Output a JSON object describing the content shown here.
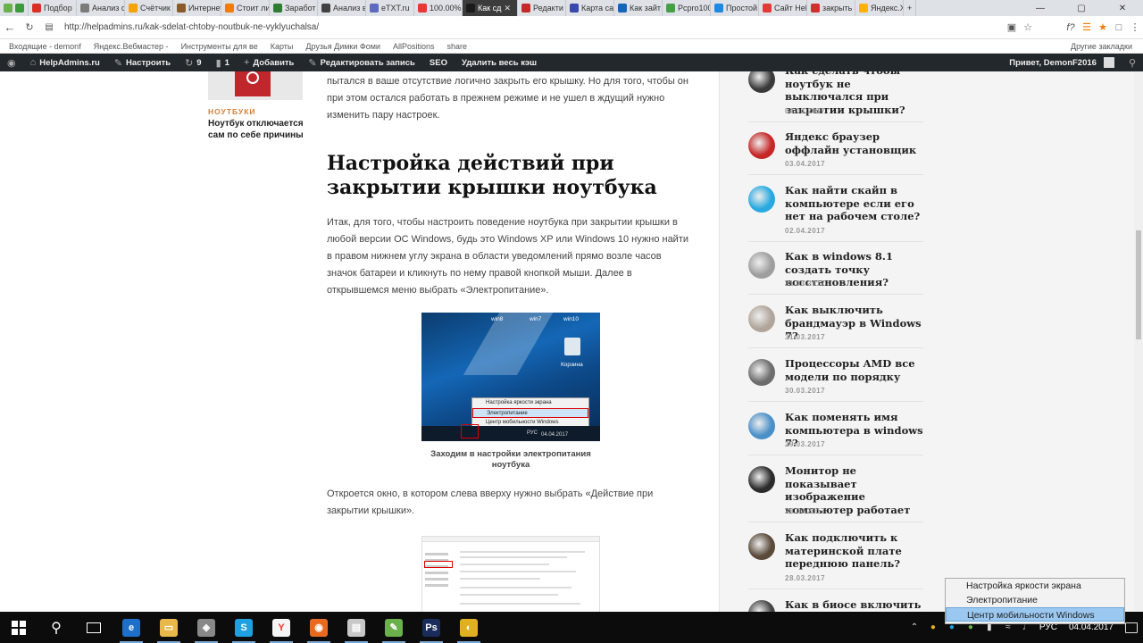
{
  "browser": {
    "tabs": [
      {
        "label": "Подбор",
        "color": "#d93025"
      },
      {
        "label": "Анализ с",
        "color": "#7b7b7b"
      },
      {
        "label": "Счётчик",
        "color": "#f4a300"
      },
      {
        "label": "Интернет",
        "color": "#8b5a2b"
      },
      {
        "label": "Стоит ли",
        "color": "#f57c00"
      },
      {
        "label": "Заработ",
        "color": "#2e7d32"
      },
      {
        "label": "Анализ в",
        "color": "#424242"
      },
      {
        "label": "eTXT.ru",
        "color": "#5c6bc0"
      },
      {
        "label": "100.00%",
        "color": "#e53935"
      },
      {
        "label": "Как сд",
        "color": "#1a1a1a",
        "active": true
      },
      {
        "label": "Редакти",
        "color": "#c62828"
      },
      {
        "label": "Карта са",
        "color": "#3949ab"
      },
      {
        "label": "Как зайт",
        "color": "#1565c0"
      },
      {
        "label": "Pcpro100",
        "color": "#43a047"
      },
      {
        "label": "Простой",
        "color": "#1e88e5"
      },
      {
        "label": "Сайт Hel",
        "color": "#e53935"
      },
      {
        "label": "закрыть",
        "color": "#d32f2f"
      },
      {
        "label": "Яндекс.Х",
        "color": "#ffb300"
      }
    ],
    "url": "http://helpadmins.ru/kak-sdelat-chtoby-noutbuk-ne-vyklyuchalsa/",
    "bookmarks": [
      "Входящие - demonf",
      "Яндекс.Вебмастер -",
      "Инструменты для ве",
      "Карты",
      "Друзья Димки Фоми",
      "AllPositions",
      "share"
    ],
    "other_bookmarks": "Другие закладки"
  },
  "wp_admin_bar": {
    "site": "HelpAdmins.ru",
    "customize": "Настроить",
    "updates_count": "9",
    "comments_count": "1",
    "add_new": "Добавить",
    "edit_post": "Редактировать запись",
    "seo": "SEO",
    "clear_cache": "Удалить весь кэш",
    "greeting": "Привет, DemonF2016"
  },
  "left_widget": {
    "category": "НОУТБУКИ",
    "caption": "Ноутбук отключается сам по себе причины"
  },
  "article": {
    "intro_paragraph": "пытался в ваше отсутствие логично закрыть его крышку. Но для того, чтобы он при этом остался работать в прежнем режиме и не ушел в ждущий нужно изменить пару настроек.",
    "heading": "Настройка действий при закрытии крышки ноутбука",
    "paragraph_2": "Итак, для того, чтобы настроить поведение ноутбука при закрытии крышки в любой версии ОС Windows, будь это Windows XP или Windows 10 нужно найти в правом нижнем углу экрана в области уведомлений прямо возле часов значок батареи и кликнуть по нему правой кнопкой мыши. Далее в открывшемся меню выбрать «Электропитание».",
    "image_1": {
      "labels": [
        "win8",
        "win7",
        "win10"
      ],
      "recycle_bin": "Корзина",
      "menu": [
        "Настройка яркости экрана",
        "Электропитание",
        "Центр мобильности Windows"
      ],
      "tray_lang": "РУС",
      "tray_date": "04.04.2017"
    },
    "caption_1": "Заходим в настройки электропитания ноутбука",
    "paragraph_3": "Откроется окно, в котором слева вверху нужно выбрать «Действие при закрытии крышки»."
  },
  "sidebar": {
    "items": [
      {
        "title": "Как сделать чтобы ноутбук не выключался при закрытии крышки?",
        "date": "04.04.2017",
        "thumb": "#3a3a3a"
      },
      {
        "title": "Яндекс браузер оффлайн установщик",
        "date": "03.04.2017",
        "thumb": "#c62828"
      },
      {
        "title": "Как найти скайп в компьютере если его нет на рабочем столе?",
        "date": "02.04.2017",
        "thumb": "#29a9e0"
      },
      {
        "title": "Как в windows 8.1 создать точку восстановления?",
        "date": "31.03.2017",
        "thumb": "#9e9e9e"
      },
      {
        "title": "Как выключить брандмауэр в Windows 7?",
        "date": "31.03.2017",
        "thumb": "#b0a59a"
      },
      {
        "title": "Процессоры AMD все модели по порядку",
        "date": "30.03.2017",
        "thumb": "#6d6d6d"
      },
      {
        "title": "Как поменять имя компьютера в windows 7?",
        "date": "29.03.2017",
        "thumb": "#4a90c8"
      },
      {
        "title": "Монитор не показывает изображение компьютер работает",
        "date": "28.03.2017",
        "thumb": "#2b2b2b"
      },
      {
        "title": "Как подключить к материнской плате переднюю панель?",
        "date": "28.03.2017",
        "thumb": "#5a4a3a"
      },
      {
        "title": "Как в биосе включить",
        "date": "",
        "thumb": "#444"
      }
    ]
  },
  "context_menu": {
    "items": [
      "Настройка яркости экрана",
      "Электропитание",
      "Центр мобильности Windows"
    ],
    "highlighted_index": 2
  },
  "taskbar": {
    "apps": [
      {
        "name": "edge",
        "color": "#1e6fc9",
        "glyph": "e"
      },
      {
        "name": "explorer",
        "color": "#e8b94a",
        "glyph": "▭"
      },
      {
        "name": "app3",
        "color": "#888",
        "glyph": "◈"
      },
      {
        "name": "skype",
        "color": "#1fa0e0",
        "glyph": "S"
      },
      {
        "name": "yandex",
        "color": "#f5f5f5",
        "glyph": "Y"
      },
      {
        "name": "firefox",
        "color": "#e86a1e",
        "glyph": "◉"
      },
      {
        "name": "app7",
        "color": "#c8c8c8",
        "glyph": "▤"
      },
      {
        "name": "notepad",
        "color": "#6ab04c",
        "glyph": "✎"
      },
      {
        "name": "photoshop",
        "color": "#1a2c5b",
        "glyph": "Ps"
      },
      {
        "name": "app10",
        "color": "#e0b020",
        "glyph": "◐"
      }
    ],
    "lang": "РУС",
    "date": "04.04.2017"
  }
}
